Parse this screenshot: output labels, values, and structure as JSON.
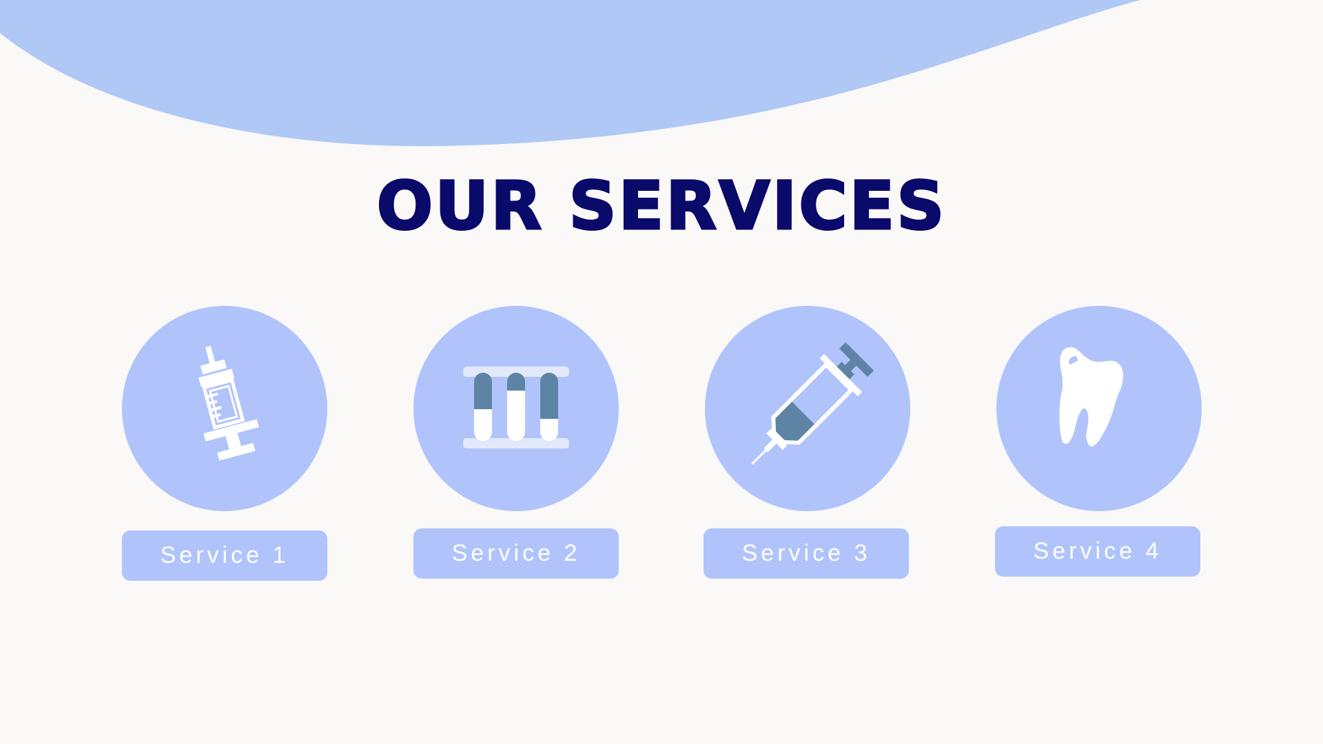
{
  "page": {
    "title": "OUR SERVICES"
  },
  "colors": {
    "background": "#faf9f8",
    "accent": "#b0c4fb",
    "title": "#0a0a6b",
    "icon_dark": "#5d84a5",
    "icon_light": "#ffffff"
  },
  "services": [
    {
      "label": "Service 1",
      "icon": "vaccine-syringe-icon"
    },
    {
      "label": "Service 2",
      "icon": "test-tubes-icon"
    },
    {
      "label": "Service 3",
      "icon": "syringe-icon"
    },
    {
      "label": "Service 4",
      "icon": "tooth-icon"
    }
  ]
}
